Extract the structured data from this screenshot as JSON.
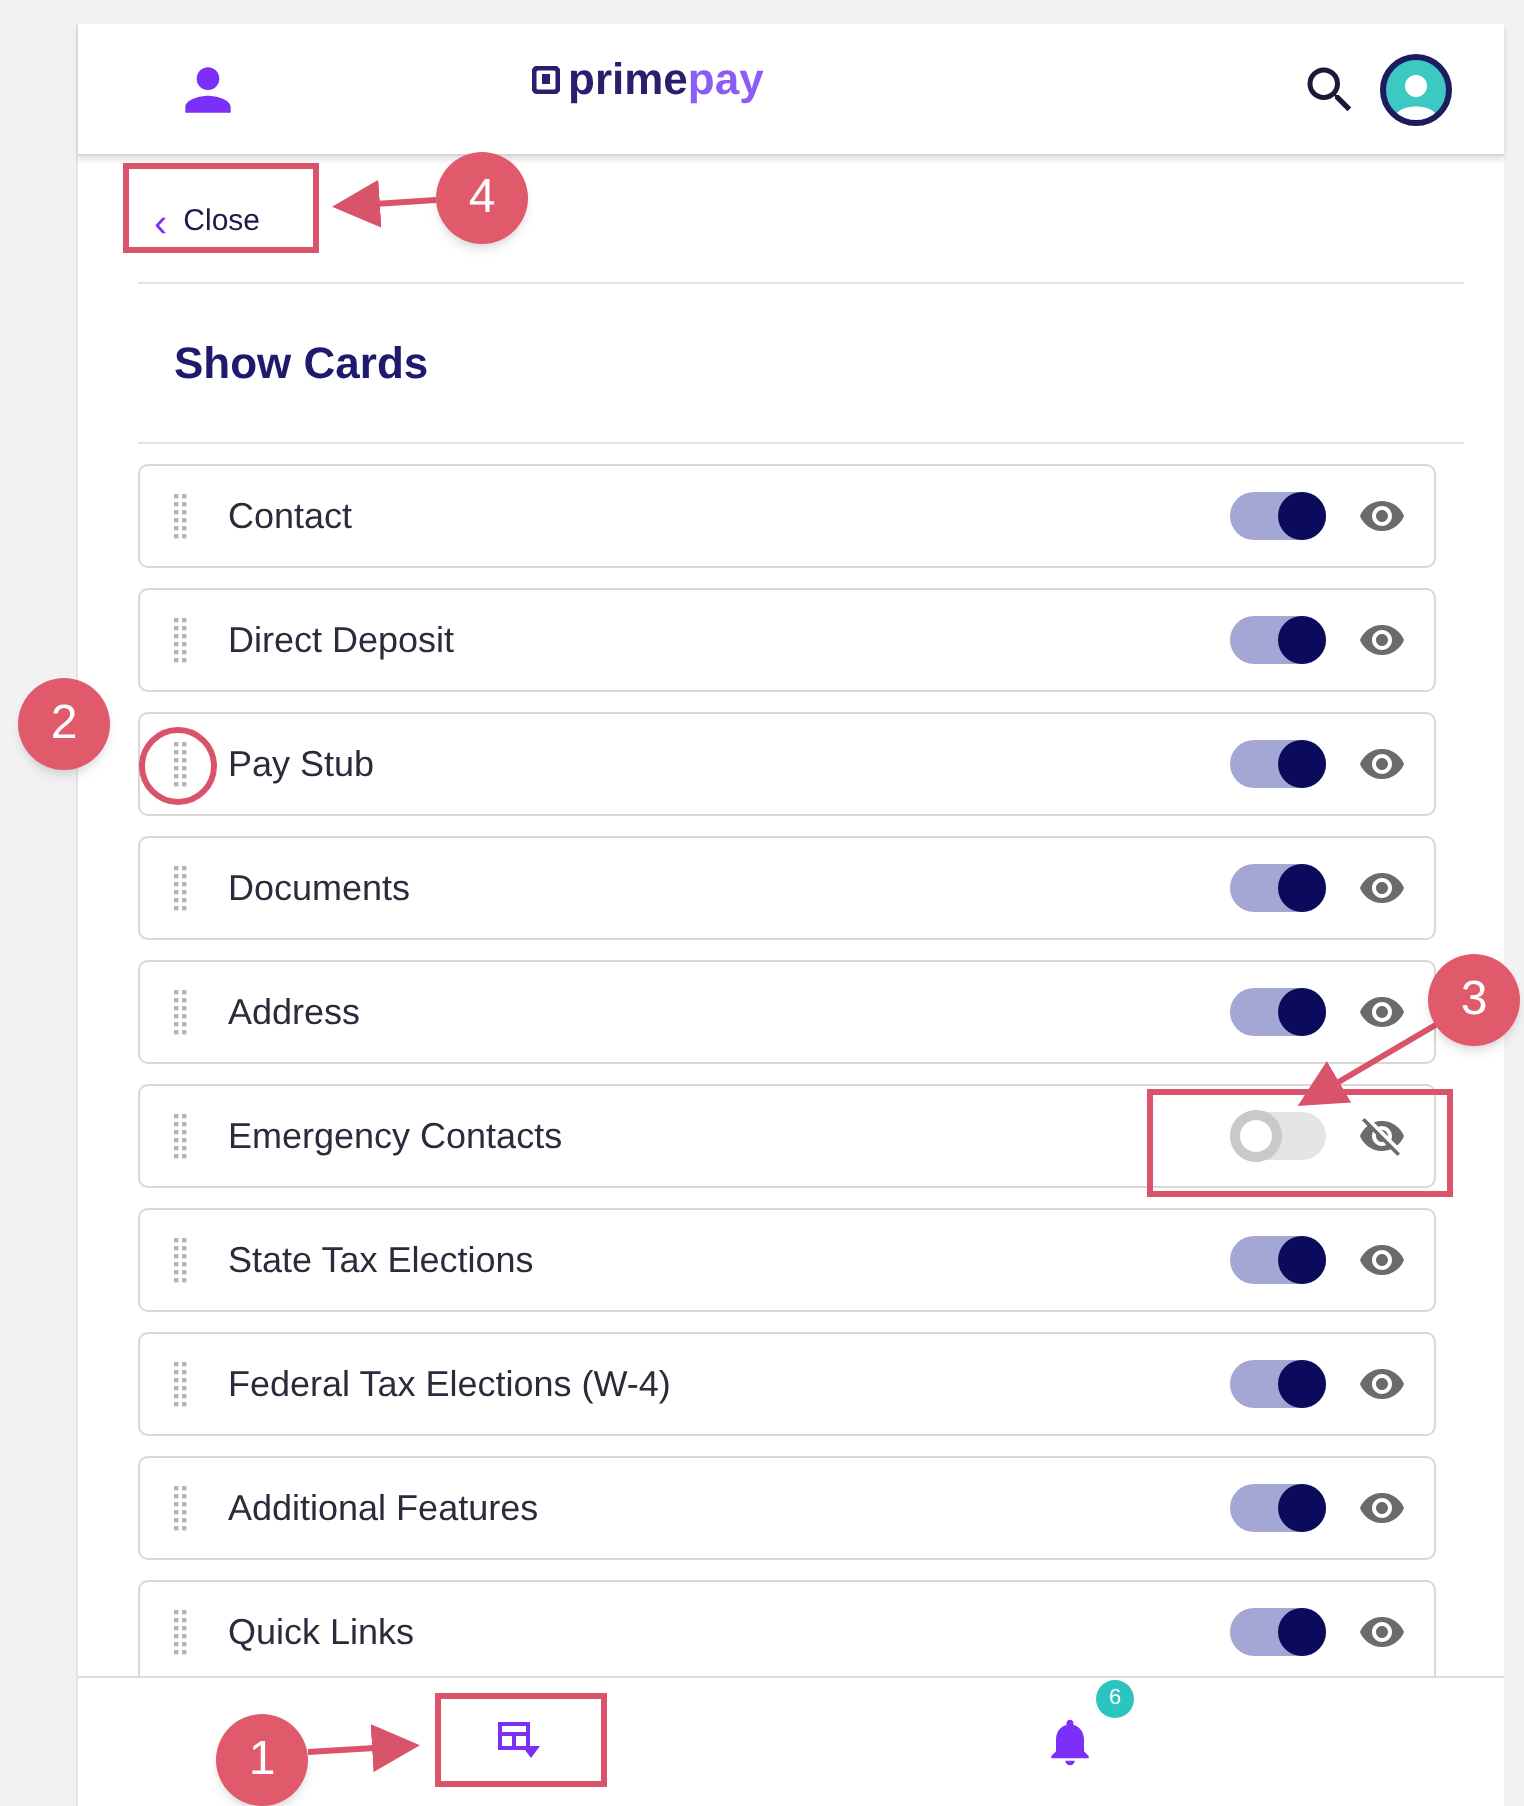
{
  "header": {
    "logo": [
      "prime",
      "pay"
    ]
  },
  "close_link": {
    "chevron": "‹",
    "label": "Close"
  },
  "title": "Show Cards",
  "cards": [
    {
      "label": "Contact",
      "on": true
    },
    {
      "label": "Direct Deposit",
      "on": true
    },
    {
      "label": "Pay Stub",
      "on": true
    },
    {
      "label": "Documents",
      "on": true
    },
    {
      "label": "Address",
      "on": true
    },
    {
      "label": "Emergency Contacts",
      "on": false
    },
    {
      "label": "State Tax Elections",
      "on": true
    },
    {
      "label": "Federal Tax Elections (W-4)",
      "on": true
    },
    {
      "label": "Additional Features",
      "on": true
    },
    {
      "label": "Quick Links",
      "on": true
    }
  ],
  "bottom_nav": {
    "notification_count": "6"
  },
  "callouts": [
    {
      "label": "4",
      "kind": "close"
    },
    {
      "label": "2",
      "kind": "handle"
    },
    {
      "label": "3",
      "kind": "toggle"
    },
    {
      "label": "1",
      "kind": "nav"
    }
  ]
}
